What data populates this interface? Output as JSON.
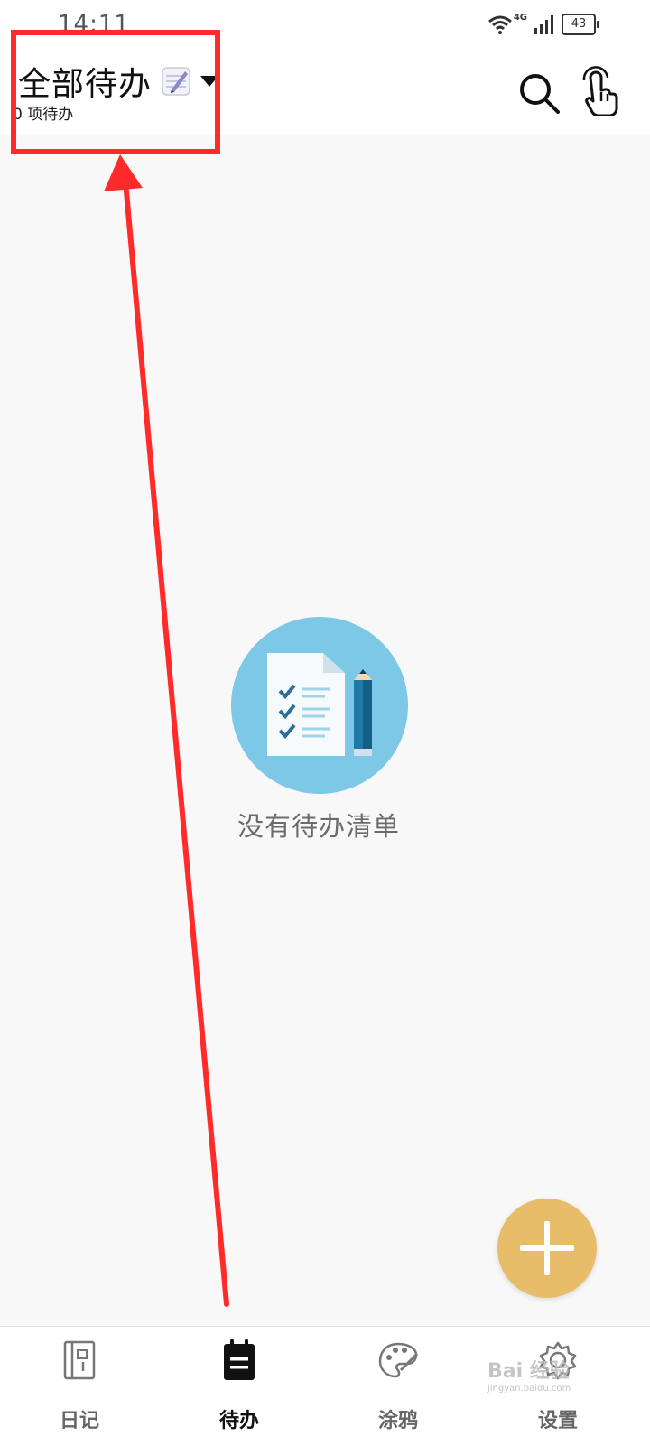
{
  "status_bar": {
    "time": "14:11",
    "network": "4G",
    "battery": "43"
  },
  "header": {
    "title": "全部待办",
    "subtitle": "0 项待办"
  },
  "empty_state": {
    "message": "没有待办清单"
  },
  "bottom_nav": {
    "items": [
      {
        "label": "日记",
        "icon": "diary-icon"
      },
      {
        "label": "待办",
        "icon": "todo-icon",
        "active": true
      },
      {
        "label": "涂鸦",
        "icon": "palette-icon"
      },
      {
        "label": "设置",
        "icon": "gear-icon"
      }
    ]
  },
  "watermark": {
    "brand": "Bai 经验",
    "url": "jingyan.baidu.com"
  },
  "colors": {
    "accent": "#e7bd6a",
    "illustration_bg": "#7cc8e6",
    "annotation": "#ff2a2a"
  }
}
